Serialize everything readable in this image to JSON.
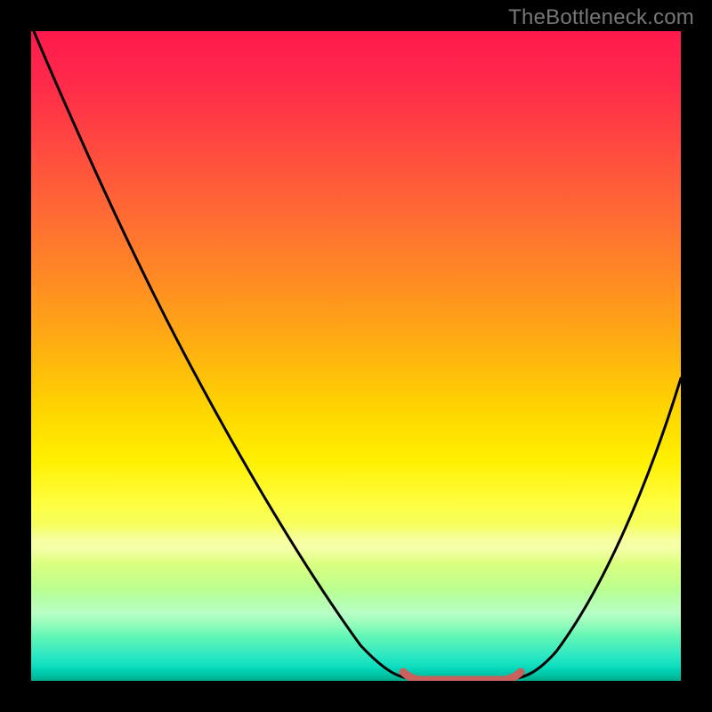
{
  "watermark": "TheBottleneck.com",
  "colors": {
    "frame": "#000000",
    "curve": "#000000",
    "bottom_marker": "#c9615c",
    "gradient_top": "#ff1a4d",
    "gradient_mid": "#fff000",
    "gradient_bottom": "#00c9a7"
  },
  "chart_data": {
    "type": "line",
    "title": "",
    "xlabel": "",
    "ylabel": "",
    "xlim": [
      0,
      100
    ],
    "ylim": [
      0,
      100
    ],
    "grid": false,
    "legend": false,
    "annotations": [
      {
        "text": "TheBottleneck.com",
        "position": "top-right"
      }
    ],
    "series": [
      {
        "name": "bottleneck-curve",
        "color": "#000000",
        "x": [
          0,
          5,
          10,
          15,
          20,
          25,
          30,
          35,
          40,
          45,
          50,
          55,
          58,
          62,
          66,
          70,
          74,
          78,
          82,
          86,
          90,
          95,
          100
        ],
        "values": [
          100,
          92,
          84,
          76,
          68,
          59,
          50,
          42,
          33,
          24,
          15,
          7,
          2,
          0,
          0,
          0,
          2,
          6,
          12,
          19,
          27,
          38,
          50
        ]
      },
      {
        "name": "optimal-range-marker",
        "color": "#c9615c",
        "x": [
          58,
          60,
          62,
          64,
          66,
          68,
          70,
          72,
          74
        ],
        "values": [
          1.2,
          0.2,
          0,
          0,
          0,
          0,
          0,
          0.2,
          1.2
        ]
      }
    ],
    "background_gradient_stops": [
      {
        "pos": 0,
        "color": "#ff1a4d"
      },
      {
        "pos": 50,
        "color": "#ffd400"
      },
      {
        "pos": 72,
        "color": "#fffd3b"
      },
      {
        "pos": 100,
        "color": "#00c9a7"
      }
    ]
  }
}
